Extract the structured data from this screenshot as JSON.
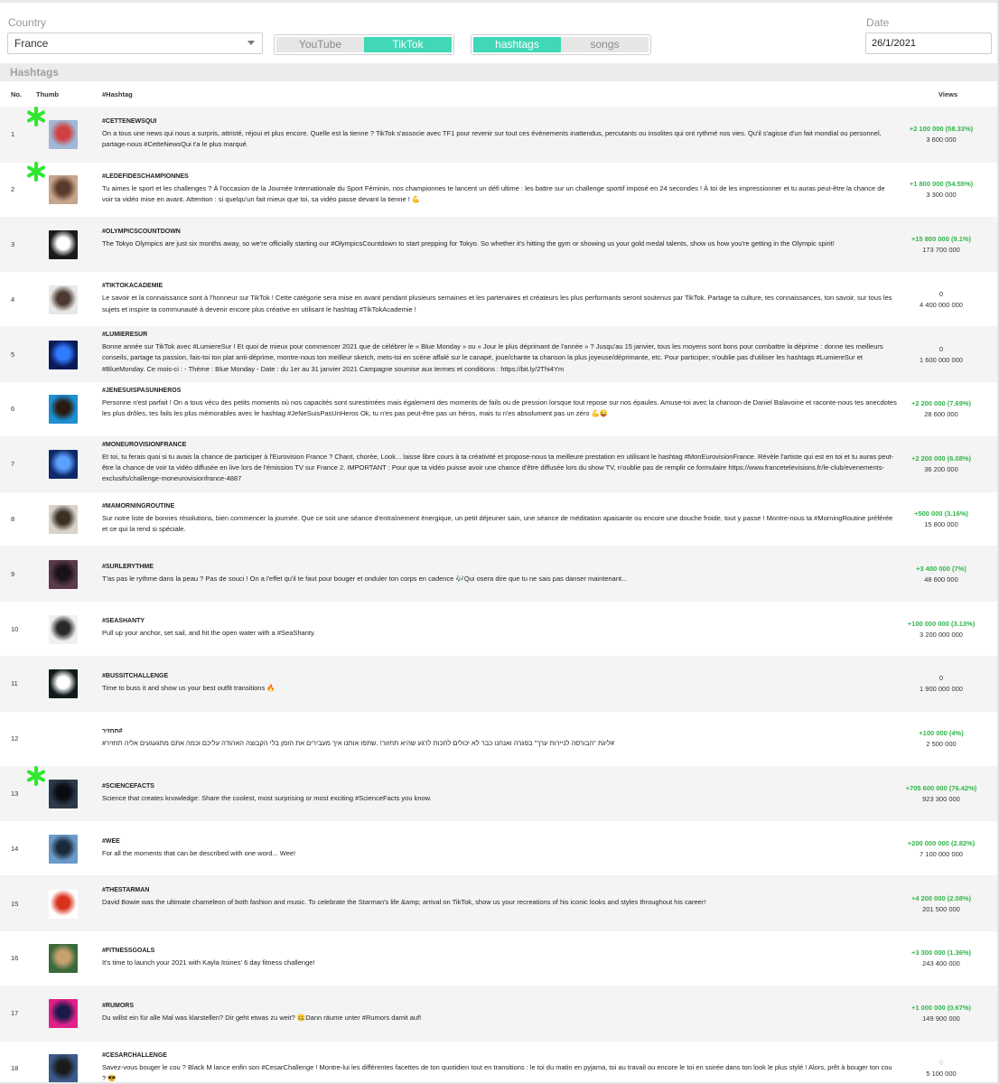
{
  "filters": {
    "country_label": "Country",
    "country_value": "France",
    "platform_options": [
      {
        "label": "YouTube",
        "active": false
      },
      {
        "label": "TikTok",
        "active": true
      }
    ],
    "type_options": [
      {
        "label": "hashtags",
        "active": true
      },
      {
        "label": "songs",
        "active": false
      }
    ],
    "date_label": "Date",
    "date_value": "26/1/2021"
  },
  "section": {
    "title": "Hashtags"
  },
  "table": {
    "columns": {
      "no": "No.",
      "thumb": "Thumb",
      "hashtag": "#Hashtag",
      "views": "Views"
    },
    "rows": [
      {
        "no": "1",
        "tag": "#CETTENEWSQUI",
        "desc": "On a tous une news qui nous a surpris, attristé, réjoui et plus encore. Quelle est la tienne ? TikTok s'associe avec TF1 pour revenir sur tout ces évènements inattendus, percutants ou insolites qui ont rythmé nos vies. Qu'il s'agisse d'un fait mondial ou personnel, partage-nous #CetteNewsQui t'a le plus marqué.",
        "change": "+2 100 000 (58.33%)",
        "views": "3 600 000",
        "star": true,
        "thumb_colors": [
          "#9fb8d6",
          "#d04040"
        ]
      },
      {
        "no": "2",
        "tag": "#LEDEFIDESCHAMPIONNES",
        "desc": "Tu aimes le sport et les challenges ? À l'occasion de la Journée Internationale du Sport Féminin, nos championnes te lancent un défi ultime : les battre sur un challenge sportif imposé en 24 secondes ! À toi de les impressionner et tu auras peut-être la chance de voir ta vidéo mise en avant. Attention : si quelqu'un fait mieux que toi, sa vidéo passe devant la tienne ! 💪",
        "change": "+1 800 000 (54.55%)",
        "views": "3 300 000",
        "star": true,
        "thumb_colors": [
          "#c7a58a",
          "#5a3a2a"
        ]
      },
      {
        "no": "3",
        "tag": "#OLYMPICSCOUNTDOWN",
        "desc": "The Tokyo Olympics are just six months away, so we're officially starting our #OlympicsCountdown to start prepping for Tokyo. So whether it's hitting the gym or showing us your gold medal talents, show us how you're getting in the Olympic spirit!",
        "change": "+15 800 000 (9.1%)",
        "views": "173 700 000",
        "star": false,
        "thumb_colors": [
          "#1a1a1a",
          "#ffffff"
        ]
      },
      {
        "no": "4",
        "tag": "#TIKTOKACADEMIE",
        "desc": "Le savoir et la connaissance sont à l'honneur sur TikTok ! Cette catégorie sera mise en avant pendant plusieurs semaines et les partenaires et créateurs les plus performants seront soutenus par TikTok. Partage ta culture, tes connaissances, ton savoir, sur tous les sujets et inspire ta communauté à devenir encore plus créative en utilisant le hashtag #TikTokAcademie !",
        "change": "0",
        "views": "4 400 000 000",
        "star": false,
        "zero": true,
        "thumb_colors": [
          "#e8e8e8",
          "#4a3a30"
        ]
      },
      {
        "no": "5",
        "tag": "#LUMIERESUR",
        "desc": "Bonne année sur TikTok avec #LumiereSur ! Et quoi de mieux pour commencer 2021 que de célébrer le « Blue Monday » ou « Jour le plus déprimant de l'année » ? Jusqu'au 15 janvier, tous les moyens sont bons pour combattre la déprime : donne tes meilleurs conseils, partage ta passion, fais-toi ton plat anti-déprime, montre-nous ton meilleur sketch, mets-toi en scène affalé sur le canapé, joue/chante ta chanson la plus joyeuse/déprimante, etc. Pour participer, n'oublie pas d'utiliser les hashtags #LumiereSur et #BlueMonday. Ce mois-ci : - Thème : Blue Monday - Date : du 1er au 31 janvier 2021 Campagne soumise aux termes et conditions : https://bit.ly/2Thi4Ym",
        "change": "0",
        "views": "1 600 000 000",
        "star": false,
        "zero": true,
        "thumb_colors": [
          "#0a1a5a",
          "#2f7bff"
        ]
      },
      {
        "no": "6",
        "tag": "#JENESUISPASUNHEROS",
        "desc": "Personne n'est parfait ! On a tous vécu des petits moments où nos capacités sont surestimées mais également des moments de fails ou de pression lorsque tout repose sur nos épaules. Amuse-toi avec la chanson de Daniel Balavoine et raconte-nous tes anecdotes les plus drôles, tes fails les plus mémorables avec le hashtag #JeNeSuisPasUnHeros Ok, tu n'es pas peut-être pas un héros, mais tu n'es absolument pas un zéro 💪😜",
        "change": "+2 200 000 (7.69%)",
        "views": "28 600 000",
        "star": false,
        "thumb_colors": [
          "#1e8fd0",
          "#2a1a10"
        ]
      },
      {
        "no": "7",
        "tag": "#MONEUROVISIONFRANCE",
        "desc": "Et toi, tu ferais quoi si tu avais la chance de participer à l'Eurovision France ? Chant, chorée, Look... laisse libre cours à ta créativité et propose-nous ta meilleure prestation en utilisant le hashtag #MonEurovisionFrance. Révèle l'artiste qui est en toi et tu auras peut-être la chance de voir ta vidéo diffusée en live lors de l'émission TV sur France 2. IMPORTANT : Pour que ta vidéo puisse avoir une chance d'être diffusée lors du show TV, n'oublie pas de remplir ce formulaire https://www.francetelevisions.fr/le-club/evenements-exclusifs/challenge-moneurovisionfrance-4887",
        "change": "+2 200 000 (6.08%)",
        "views": "36 200 000",
        "star": false,
        "thumb_colors": [
          "#0f2a6a",
          "#5aa0ff"
        ]
      },
      {
        "no": "8",
        "tag": "#MAMORNINGROUTINE",
        "desc": "Sur notre liste de bonnes résolutions, bien commencer la journée. Que ce soit une séance d'entraînement énergique, un petit déjeuner sain, une séance de méditation apaisante ou encore une douche froide, tout y passe ! Montre-nous ta #MorningRoutine préférée et ce qui la rend si spéciale.",
        "change": "+500 000 (3.16%)",
        "views": "15 800 000",
        "star": false,
        "thumb_colors": [
          "#d8d2c8",
          "#3a3026"
        ]
      },
      {
        "no": "9",
        "tag": "#SURLERYTHME",
        "desc": "T'as pas le rythme dans la peau ? Pas de souci ! On a l'effet qu'il te faut pour bouger et onduler ton corps en cadence 🎶Qui osera dire que tu ne sais pas danser maintenant...",
        "change": "+3 400 000 (7%)",
        "views": "48 600 000",
        "star": false,
        "thumb_colors": [
          "#5a3a4a",
          "#1a1018"
        ]
      },
      {
        "no": "10",
        "tag": "#SEASHANTY",
        "desc": "Pull up your anchor, set sail, and hit the open water with a #SeaShanty.",
        "change": "+100 000 000 (3.13%)",
        "views": "3 200 000 000",
        "star": false,
        "thumb_colors": [
          "#f0f0f0",
          "#2a2a2a"
        ]
      },
      {
        "no": "11",
        "tag": "#BUSSITCHALLENGE",
        "desc": "Time to buss it and show us your best outfit transitions 🔥",
        "change": "0",
        "views": "1 900 000 000",
        "star": false,
        "zero": true,
        "thumb_colors": [
          "#0f1a1a",
          "#ffffff"
        ]
      },
      {
        "no": "12",
        "tag": "#תחזיר",
        "desc": "#ליגת \"הבורסה לניירות ערך\" בפגרה ואנחנו כבר לא יכולים לחכות לרגע שהיא תחזור! .שתפו אותנו איך מעבירים את הזמן בלי הקבוצה האהודה עליכם וכמה אתם מתגעגעים אליה תחזיר#",
        "change": "+100 000 (4%)",
        "views": "2 500 000",
        "star": false,
        "rtl": true,
        "no_thumb": true
      },
      {
        "no": "13",
        "tag": "#SCIENCEFACTS",
        "desc": "Science that creates knowledge: Share the coolest, most surprising or most exciting #ScienceFacts you know.",
        "change": "+705 600 000 (76.42%)",
        "views": "923 300 000",
        "star": true,
        "thumb_colors": [
          "#2a3a4a",
          "#0a0a10"
        ]
      },
      {
        "no": "14",
        "tag": "#WEE",
        "desc": "For all the moments that can be described with one word... Wee!",
        "change": "+200 000 000 (2.82%)",
        "views": "7 100 000 000",
        "star": false,
        "thumb_colors": [
          "#6a9ac8",
          "#1a2a3a"
        ]
      },
      {
        "no": "15",
        "tag": "#THESTARMAN",
        "desc": "David Bowie was the ultimate chameleon of both fashion and music. To celebrate the Starman's life &amp; arrival on TikTok, show us your recreations of his iconic looks and styles throughout his career!",
        "change": "+4 200 000 (2.08%)",
        "views": "201 500 000",
        "star": false,
        "thumb_colors": [
          "#ffffff",
          "#d8321e"
        ]
      },
      {
        "no": "16",
        "tag": "#FITNESSGOALS",
        "desc": "It's time to launch your 2021 with Kayla Itsines' 6 day fitness challenge!",
        "change": "+3 300 000 (1.36%)",
        "views": "243 400 000",
        "star": false,
        "thumb_colors": [
          "#3a6a3a",
          "#c8a070"
        ]
      },
      {
        "no": "17",
        "tag": "#RUMORS",
        "desc": "Du willst ein für alle Mal was klarstellen? Dir geht etwas zu weit? 🤐Dann räume unter #Rumors damit auf!",
        "change": "+1 000 000 (0.67%)",
        "views": "149 900 000",
        "star": false,
        "thumb_colors": [
          "#e0208a",
          "#1a1a4a"
        ]
      },
      {
        "no": "18",
        "tag": "#CESARCHALLENGE",
        "desc": "Savez-vous bouger le cou ? Black M lance enfin son #CesarChallenge ! Montre-lui les différentes facettes de ton quotidien tout en transitions : le toi du matin en pyjama, toi au travail ou encore le toi en soirée dans ton look le plus stylé ! Alors, prêt à bouger ton cou ? 😎",
        "change": "0",
        "views": "5 100 000",
        "star": false,
        "faint": true,
        "thumb_colors": [
          "#3a5a8a",
          "#1a1a1a"
        ]
      }
    ]
  }
}
